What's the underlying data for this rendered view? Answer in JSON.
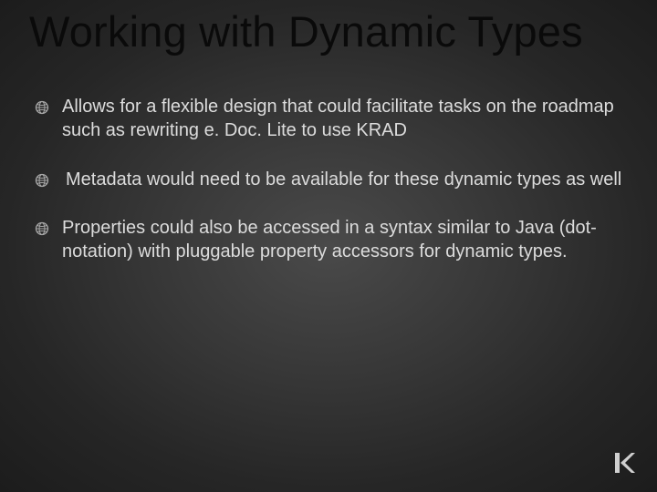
{
  "slide": {
    "title": "Working with Dynamic Types",
    "bullets": [
      "Allows for a flexible design that could facilitate tasks on the roadmap such as rewriting e. Doc. Lite to use KRAD",
      "Metadata would need to be available for these dynamic types as well",
      "Properties could also be accessed in a syntax similar to Java (dot-notation) with pluggable property accessors for dynamic types."
    ]
  }
}
